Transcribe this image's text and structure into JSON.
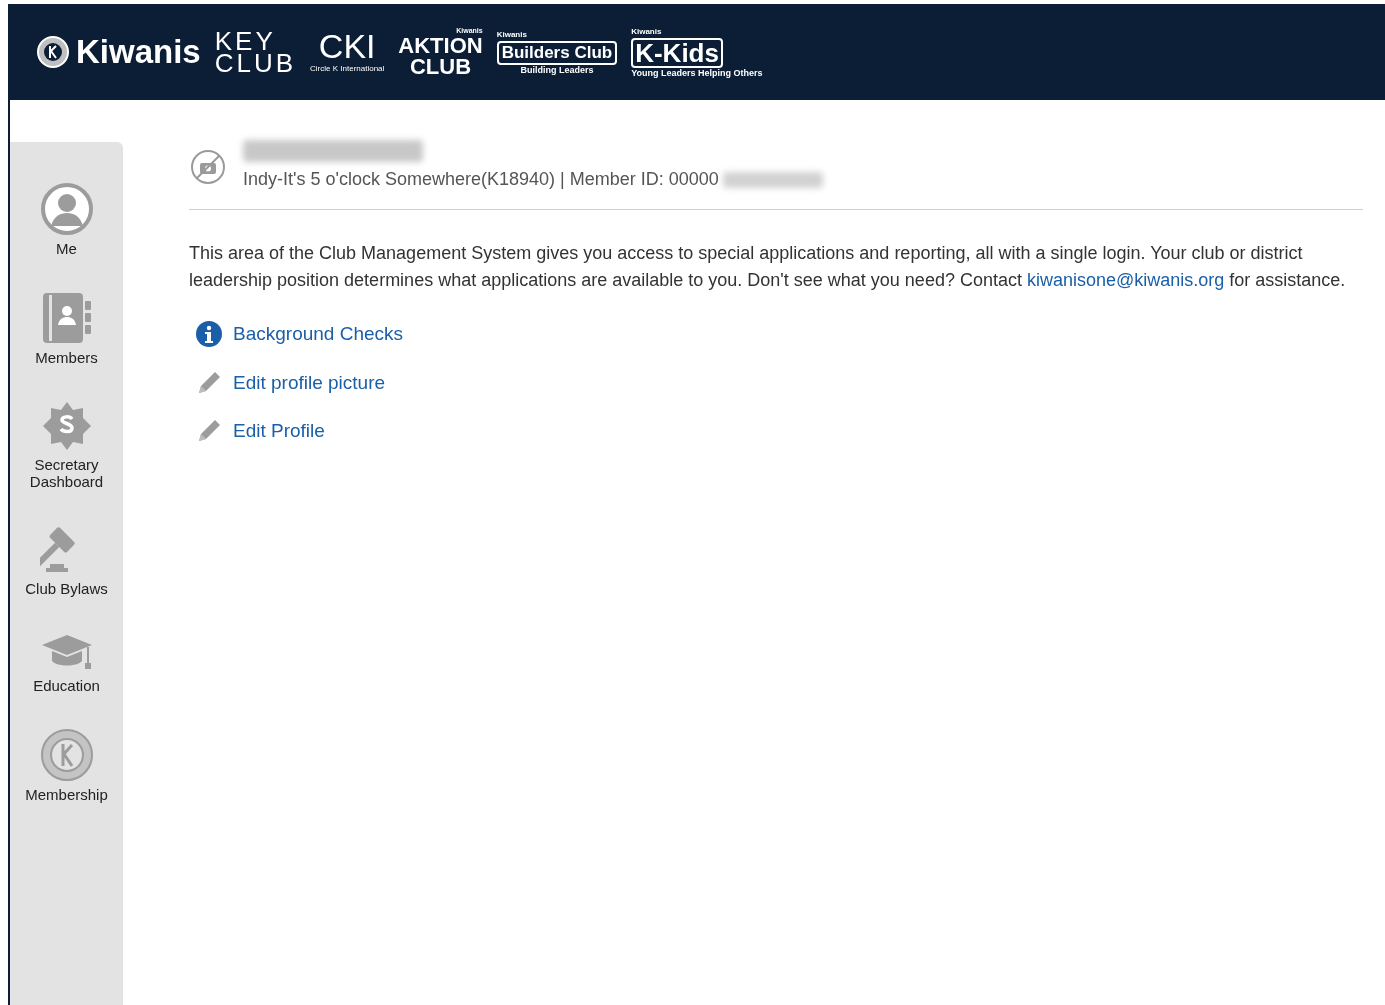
{
  "header": {
    "logos": [
      {
        "kind": "kiwanis",
        "text": "Kiwanis"
      },
      {
        "kind": "keyclub",
        "lines": [
          "KEY",
          "CLUB"
        ]
      },
      {
        "kind": "cki",
        "text": "CKI",
        "tagline": "Circle K International"
      },
      {
        "kind": "aktion",
        "brand": "Kiwanis",
        "lines": [
          "AKTION",
          "CLUB"
        ]
      },
      {
        "kind": "builders",
        "brand": "Kiwanis",
        "text": "Builders Club",
        "tagline": "Building Leaders"
      },
      {
        "kind": "kkids",
        "brand": "Kiwanis",
        "text": "K-Kids",
        "tagline": "Young Leaders Helping Others"
      }
    ]
  },
  "sidebar": {
    "items": [
      {
        "kind": "person",
        "label": "Me",
        "selected": false
      },
      {
        "kind": "contacts",
        "label": "Members",
        "selected": false
      },
      {
        "kind": "badge",
        "label": "Secretary Dashboard",
        "selected": false
      },
      {
        "kind": "gavel",
        "label": "Club Bylaws",
        "selected": false
      },
      {
        "kind": "cap",
        "label": "Education",
        "selected": false
      },
      {
        "kind": "seal",
        "label": "Membership",
        "selected": false
      }
    ]
  },
  "profile": {
    "club_line": "Indy-It's 5 o'clock Somewhere(K18940) | Member ID: 00000"
  },
  "intro": {
    "text": "This area of the Club Management System gives you access to special applications and reporting, all with a single login. Your club or district leadership position determines what applications are available to you. Don't see what you need? Contact",
    "email": "kiwanisone@kiwanis.org",
    "after": "for assistance."
  },
  "links": [
    {
      "kind": "info",
      "label": "Background Checks"
    },
    {
      "kind": "pencil",
      "label": "Edit profile picture"
    },
    {
      "kind": "pencil",
      "label": "Edit Profile"
    }
  ]
}
